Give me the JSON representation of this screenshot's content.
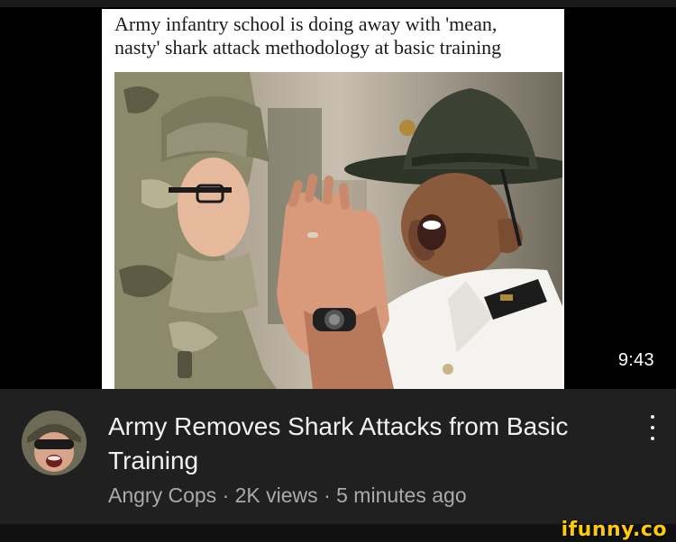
{
  "video": {
    "headline_line1": "Army infantry school is doing away with 'mean,",
    "headline_line2": "nasty' shark attack methodology at basic training",
    "duration": "9:43"
  },
  "info": {
    "title": "Army Removes Shark Attacks from Basic Training",
    "channel": "Angry Cops",
    "separator": "·",
    "views": "2K views",
    "age": "5 minutes ago"
  },
  "icons": {
    "menu": "more-vert-icon",
    "avatar": "channel-avatar"
  },
  "watermark": {
    "text": "ifunny.co"
  },
  "colors": {
    "background": "#202020",
    "title": "#f1f1f1",
    "meta": "#aaaaaa",
    "watermark": "#ffcc00"
  }
}
